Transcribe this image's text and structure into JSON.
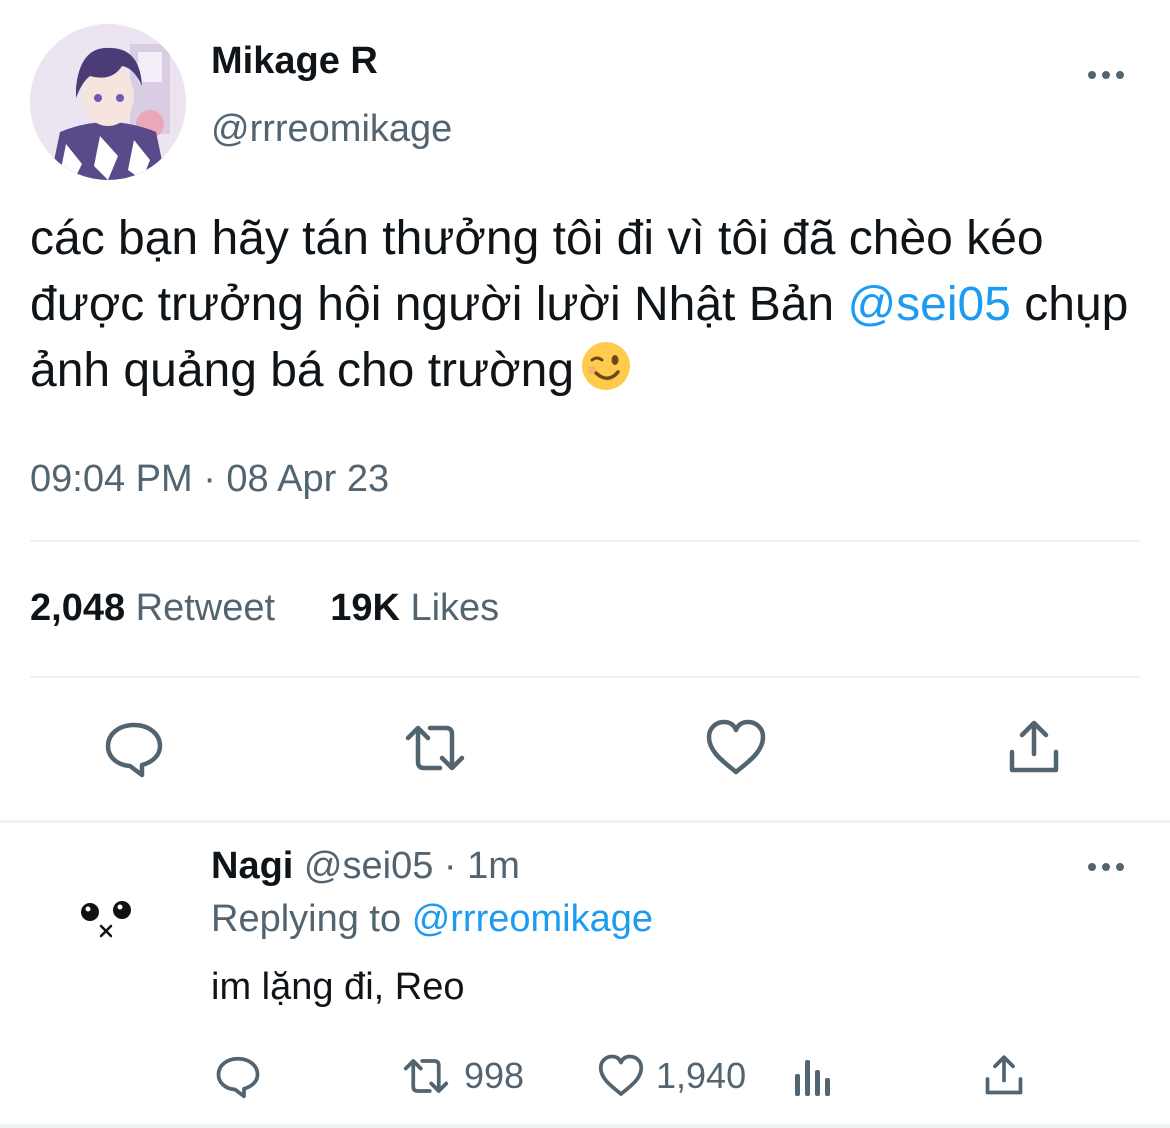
{
  "tweet": {
    "author_name": "Mikage R",
    "author_handle": "@rrreomikage",
    "text_part1": "các bạn hãy tán thưởng tôi đi vì tôi đã chèo kéo được trưởng hội người lười Nhật Bản ",
    "mention": "@sei05",
    "text_part2": " chụp ảnh quảng bá cho trường",
    "emoji": "winking-face",
    "timestamp": "09:04 PM · 08 Apr 23",
    "retweet_count": "2,048",
    "retweet_label": "Retweet",
    "likes_count": "19K",
    "likes_label": "Likes"
  },
  "actions": [
    "reply-icon",
    "retweet-icon",
    "like-icon",
    "share-icon"
  ],
  "reply": {
    "author_name": "Nagi",
    "meta": "@sei05 · 1m",
    "replying_label": "Replying to",
    "replying_to": "@rrreomikage",
    "text": "im lặng đi, Reo",
    "retweet_count": "998",
    "like_count": "1,940"
  },
  "colors": {
    "accent": "#1d9bf0",
    "text": "#0f1419",
    "secondary": "#536471",
    "divider": "#eff3f4"
  }
}
